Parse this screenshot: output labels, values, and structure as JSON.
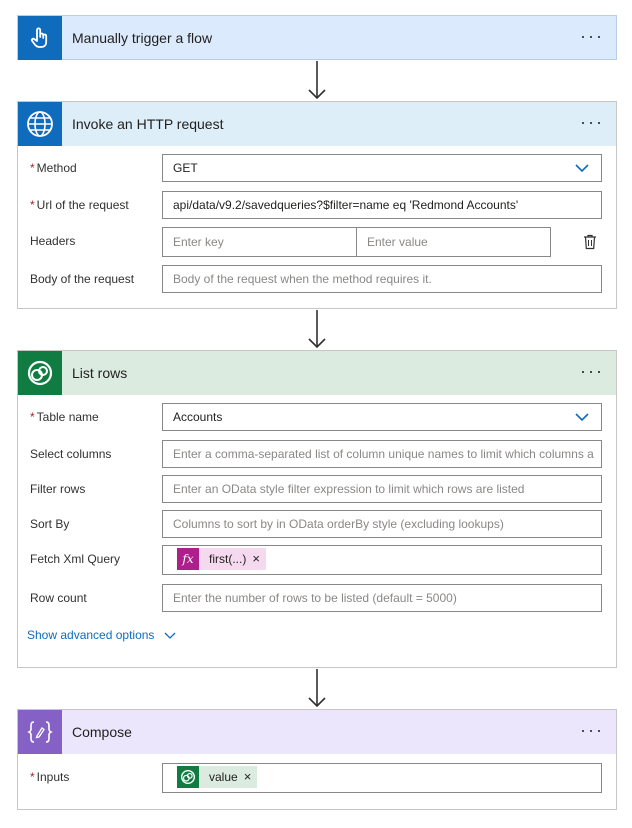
{
  "trigger": {
    "title": "Manually trigger a flow",
    "color": "#dbeafc",
    "icon_color": "#0f6cbd",
    "icon": "touch-hand-icon",
    "more": "···"
  },
  "http": {
    "title": "Invoke an HTTP request",
    "more": "···",
    "header_color": "#ddeef8",
    "icon_color": "#0f6cbd",
    "icon": "globe-icon",
    "method": {
      "label": "Method",
      "value": "GET"
    },
    "url": {
      "label": "Url of the request",
      "value": "api/data/v9.2/savedqueries?$filter=name eq 'Redmond Accounts'"
    },
    "headers": {
      "label": "Headers",
      "key_placeholder": "Enter key",
      "value_placeholder": "Enter value"
    },
    "body": {
      "label": "Body of the request",
      "placeholder": "Body of the request when the method requires it."
    }
  },
  "list_rows": {
    "title": "List rows",
    "more": "···",
    "header_color": "#dcebe0",
    "icon_color": "#107c41",
    "icon": "dataverse-icon",
    "table_name": {
      "label": "Table name",
      "value": "Accounts"
    },
    "select_columns": {
      "label": "Select columns",
      "placeholder": "Enter a comma-separated list of column unique names to limit which columns a"
    },
    "filter_rows": {
      "label": "Filter rows",
      "placeholder": "Enter an OData style filter expression to limit which rows are listed"
    },
    "sort_by": {
      "label": "Sort By",
      "placeholder": "Columns to sort by in OData orderBy style (excluding lookups)"
    },
    "fetch_xml": {
      "label": "Fetch Xml Query",
      "token": "first(...)",
      "token_icon": "fx",
      "token_color": "#ad1f8b"
    },
    "row_count": {
      "label": "Row count",
      "placeholder": "Enter the number of rows to be listed (default = 5000)"
    },
    "advanced": "Show advanced options"
  },
  "compose": {
    "title": "Compose",
    "more": "···",
    "header_color": "#ebe6fb",
    "icon_color": "#8661c5",
    "icon": "compose-icon",
    "inputs": {
      "label": "Inputs",
      "token": "value",
      "token_color": "#107c41"
    }
  },
  "required_mark": "*",
  "remove_mark": "×"
}
